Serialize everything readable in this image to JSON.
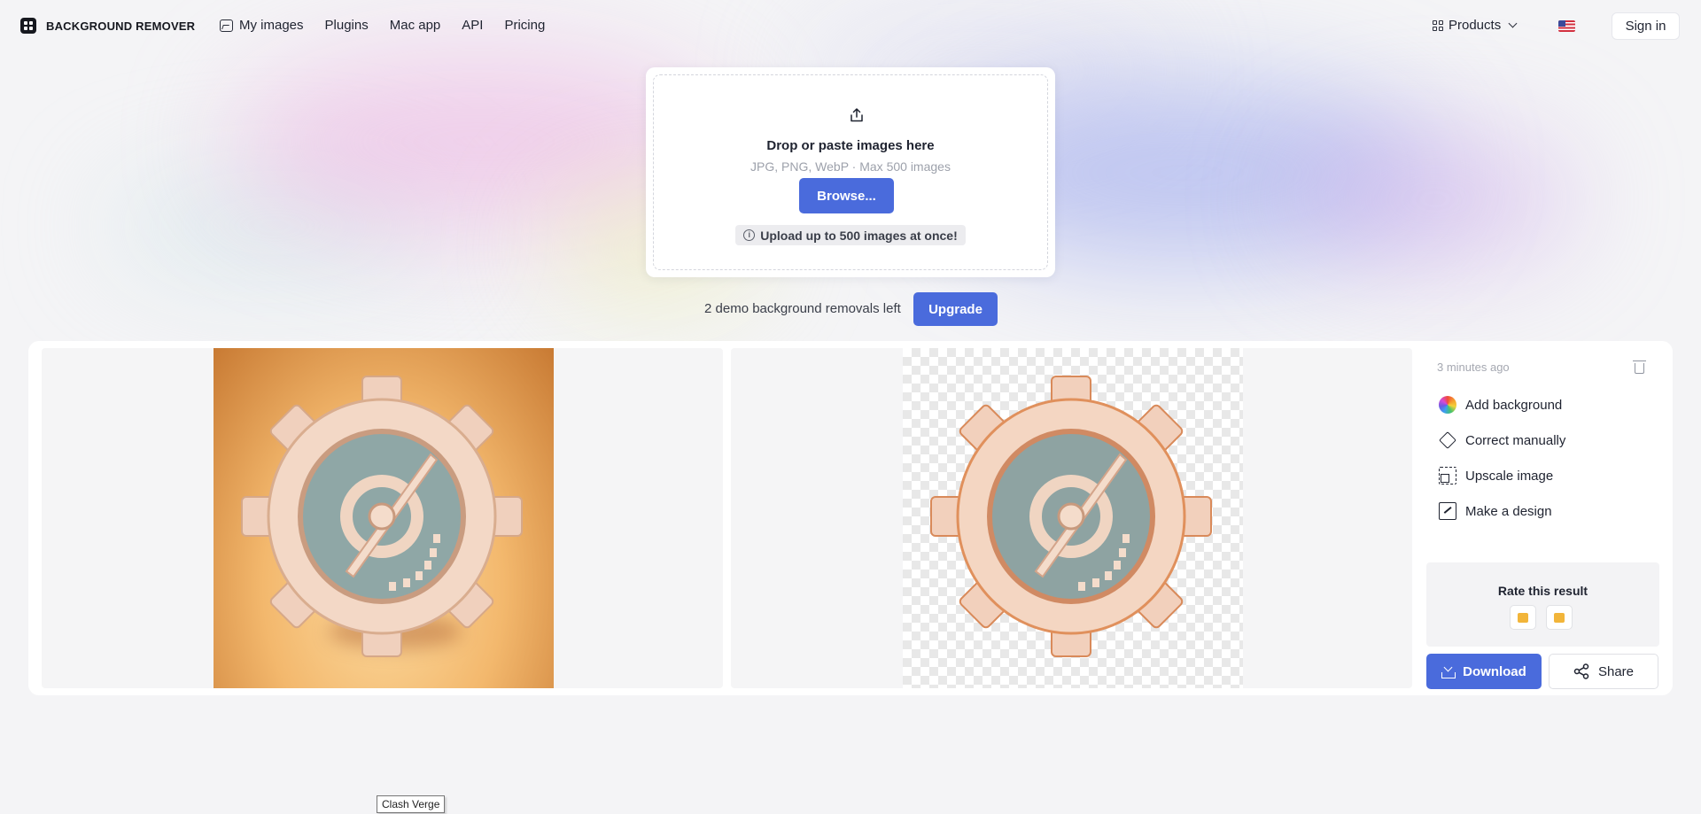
{
  "header": {
    "logo_text": "BACKGROUND REMOVER",
    "nav": [
      {
        "label": "My images",
        "icon": "image-icon"
      },
      {
        "label": "Plugins"
      },
      {
        "label": "Mac app"
      },
      {
        "label": "API"
      },
      {
        "label": "Pricing"
      }
    ],
    "products_label": "Products",
    "signin_label": "Sign in"
  },
  "upload": {
    "title": "Drop or paste images here",
    "subtitle": "JPG, PNG, WebP · Max 500 images",
    "browse_label": "Browse...",
    "info_label": "Upload up to 500 images at once!"
  },
  "demo": {
    "text": "2 demo background removals left",
    "upgrade_label": "Upgrade"
  },
  "result": {
    "timestamp": "3 minutes ago",
    "actions": [
      {
        "label": "Add background",
        "icon": "color-wheel-icon"
      },
      {
        "label": "Correct manually",
        "icon": "eraser-icon"
      },
      {
        "label": "Upscale image",
        "icon": "upscale-icon"
      },
      {
        "label": "Make a design",
        "icon": "design-icon"
      }
    ],
    "rate_title": "Rate this result",
    "download_label": "Download",
    "share_label": "Share"
  },
  "tooltip": "Clash Verge",
  "colors": {
    "accent": "#4a6bdc",
    "background": "#f4f4f6"
  }
}
